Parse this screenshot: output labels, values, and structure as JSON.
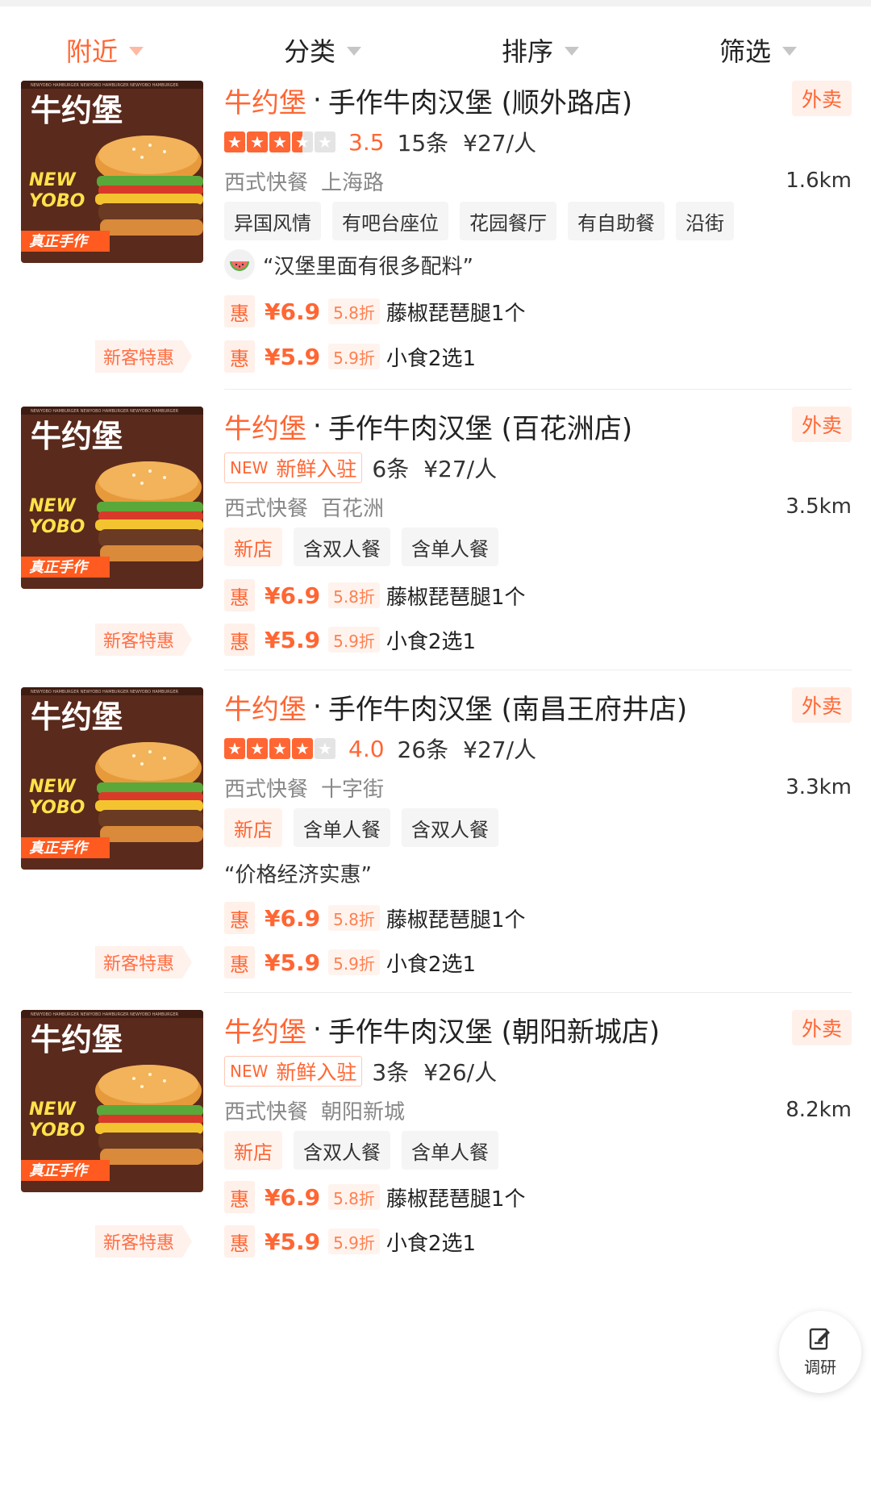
{
  "filters": [
    {
      "label": "附近",
      "active": true
    },
    {
      "label": "分类",
      "active": false
    },
    {
      "label": "排序",
      "active": false
    },
    {
      "label": "筛选",
      "active": false
    }
  ],
  "colors": {
    "accent": "#ff6633",
    "thumb_bg": "#5a2a1c",
    "thumb_band": "#ff5a1f"
  },
  "thumb_text": {
    "brand": "牛约堡",
    "en1": "NEW",
    "en2": "YOBO",
    "band": "真正手作"
  },
  "stores": [
    {
      "brand": "牛约堡",
      "sep": "·",
      "name": "手作牛肉汉堡 (顺外路店)",
      "badge": "外卖",
      "rating": 3.5,
      "score": "3.5",
      "reviews": "15条",
      "price_per": "¥27/人",
      "category": "西式快餐",
      "area": "上海路",
      "distance": "1.6km",
      "tags": [
        {
          "label": "异国风情",
          "style": "gray"
        },
        {
          "label": "有吧台座位",
          "style": "gray"
        },
        {
          "label": "花园餐厅",
          "style": "gray"
        },
        {
          "label": "有自助餐",
          "style": "gray"
        },
        {
          "label": "沿街",
          "style": "gray"
        }
      ],
      "quote": "“汉堡里面有很多配料”",
      "quote_avatar": true,
      "deals": [
        {
          "hui": "惠",
          "price": "¥6.9",
          "discount": "5.8折",
          "name": "藤椒琵琶腿1个"
        },
        {
          "hui": "惠",
          "price": "¥5.9",
          "discount": "5.9折",
          "name": "小食2选1"
        }
      ],
      "new_customer": "新客特惠"
    },
    {
      "brand": "牛约堡",
      "sep": "·",
      "name": "手作牛肉汉堡 (百花洲店)",
      "badge": "外卖",
      "new_label_en": "NEW",
      "new_label_zh": "新鲜入驻",
      "reviews": "6条",
      "price_per": "¥27/人",
      "category": "西式快餐",
      "area": "百花洲",
      "distance": "3.5km",
      "tags": [
        {
          "label": "新店",
          "style": "orange"
        },
        {
          "label": "含双人餐",
          "style": "gray"
        },
        {
          "label": "含单人餐",
          "style": "gray"
        }
      ],
      "deals": [
        {
          "hui": "惠",
          "price": "¥6.9",
          "discount": "5.8折",
          "name": "藤椒琵琶腿1个"
        },
        {
          "hui": "惠",
          "price": "¥5.9",
          "discount": "5.9折",
          "name": "小食2选1"
        }
      ],
      "new_customer": "新客特惠"
    },
    {
      "brand": "牛约堡",
      "sep": "·",
      "name": "手作牛肉汉堡 (南昌王府井店)",
      "badge": "外卖",
      "rating": 4.0,
      "score": "4.0",
      "reviews": "26条",
      "price_per": "¥27/人",
      "category": "西式快餐",
      "area": "十字街",
      "distance": "3.3km",
      "tags": [
        {
          "label": "新店",
          "style": "orange"
        },
        {
          "label": "含单人餐",
          "style": "gray"
        },
        {
          "label": "含双人餐",
          "style": "gray"
        }
      ],
      "quote": "“价格经济实惠”",
      "quote_avatar": false,
      "deals": [
        {
          "hui": "惠",
          "price": "¥6.9",
          "discount": "5.8折",
          "name": "藤椒琵琶腿1个"
        },
        {
          "hui": "惠",
          "price": "¥5.9",
          "discount": "5.9折",
          "name": "小食2选1"
        }
      ],
      "new_customer": "新客特惠"
    },
    {
      "brand": "牛约堡",
      "sep": "·",
      "name": "手作牛肉汉堡 (朝阳新城店)",
      "badge": "外卖",
      "new_label_en": "NEW",
      "new_label_zh": "新鲜入驻",
      "reviews": "3条",
      "price_per": "¥26/人",
      "category": "西式快餐",
      "area": "朝阳新城",
      "distance": "8.2km",
      "tags": [
        {
          "label": "新店",
          "style": "orange"
        },
        {
          "label": "含双人餐",
          "style": "gray"
        },
        {
          "label": "含单人餐",
          "style": "gray"
        }
      ],
      "deals": [
        {
          "hui": "惠",
          "price": "¥6.9",
          "discount": "5.8折",
          "name": "藤椒琵琶腿1个"
        },
        {
          "hui": "惠",
          "price": "¥5.9",
          "discount": "5.9折",
          "name": "小食2选1"
        }
      ],
      "new_customer": "新客特惠"
    }
  ],
  "fab": {
    "label": "调研",
    "icon": "survey-edit-icon"
  }
}
